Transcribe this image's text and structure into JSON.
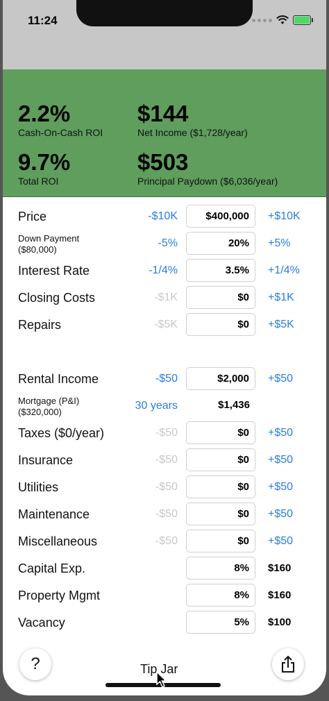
{
  "status_bar": {
    "time": "11:24"
  },
  "summary": {
    "coc_roi": {
      "value": "2.2%",
      "label": "Cash-On-Cash ROI"
    },
    "net_income": {
      "value": "$144",
      "label": "Net Income ($1,728/year)"
    },
    "total_roi": {
      "value": "9.7%",
      "label": "Total ROI"
    },
    "principal": {
      "value": "$503",
      "label": "Principal Paydown ($6,036/year)"
    }
  },
  "rows": [
    {
      "label": "Price",
      "minus": "-$10K",
      "value": "$400,000",
      "plus": "+$10K"
    },
    {
      "label": "Down Payment\n($80,000)",
      "minus": "-5%",
      "value": "20%",
      "plus": "+5%"
    },
    {
      "label": "Interest Rate",
      "minus": "-1/4%",
      "value": "3.5%",
      "plus": "+1/4%"
    },
    {
      "label": "Closing Costs",
      "minus": "-$1K",
      "value": "$0",
      "plus": "+$1K"
    },
    {
      "label": "Repairs",
      "minus": "-$5K",
      "value": "$0",
      "plus": "+$5K"
    },
    {
      "label": "Rental Income",
      "minus": "-$50",
      "value": "$2,000",
      "plus": "+$50"
    },
    {
      "label": "Mortgage (P&I)\n($320,000)",
      "minus": "30 years",
      "value": "$1,436",
      "plus": ""
    },
    {
      "label": "Taxes ($0/year)",
      "minus": "-$50",
      "value": "$0",
      "plus": "+$50"
    },
    {
      "label": "Insurance",
      "minus": "-$50",
      "value": "$0",
      "plus": "+$50"
    },
    {
      "label": "Utilities",
      "minus": "-$50",
      "value": "$0",
      "plus": "+$50"
    },
    {
      "label": "Maintenance",
      "minus": "-$50",
      "value": "$0",
      "plus": "+$50"
    },
    {
      "label": "Miscellaneous",
      "minus": "-$50",
      "value": "$0",
      "plus": "+$50"
    },
    {
      "label": "Capital Exp.",
      "minus": "",
      "value": "8%",
      "plus": "$160"
    },
    {
      "label": "Property Mgmt",
      "minus": "",
      "value": "8%",
      "plus": "$160"
    },
    {
      "label": "Vacancy",
      "minus": "",
      "value": "5%",
      "plus": "$100"
    }
  ],
  "bottom": {
    "help": "?",
    "tip_jar": "Tip Jar"
  },
  "colors": {
    "summary_bg": "#5f9e5d",
    "accent_blue": "#2a7de1",
    "disabled": "#c8c8c8"
  }
}
